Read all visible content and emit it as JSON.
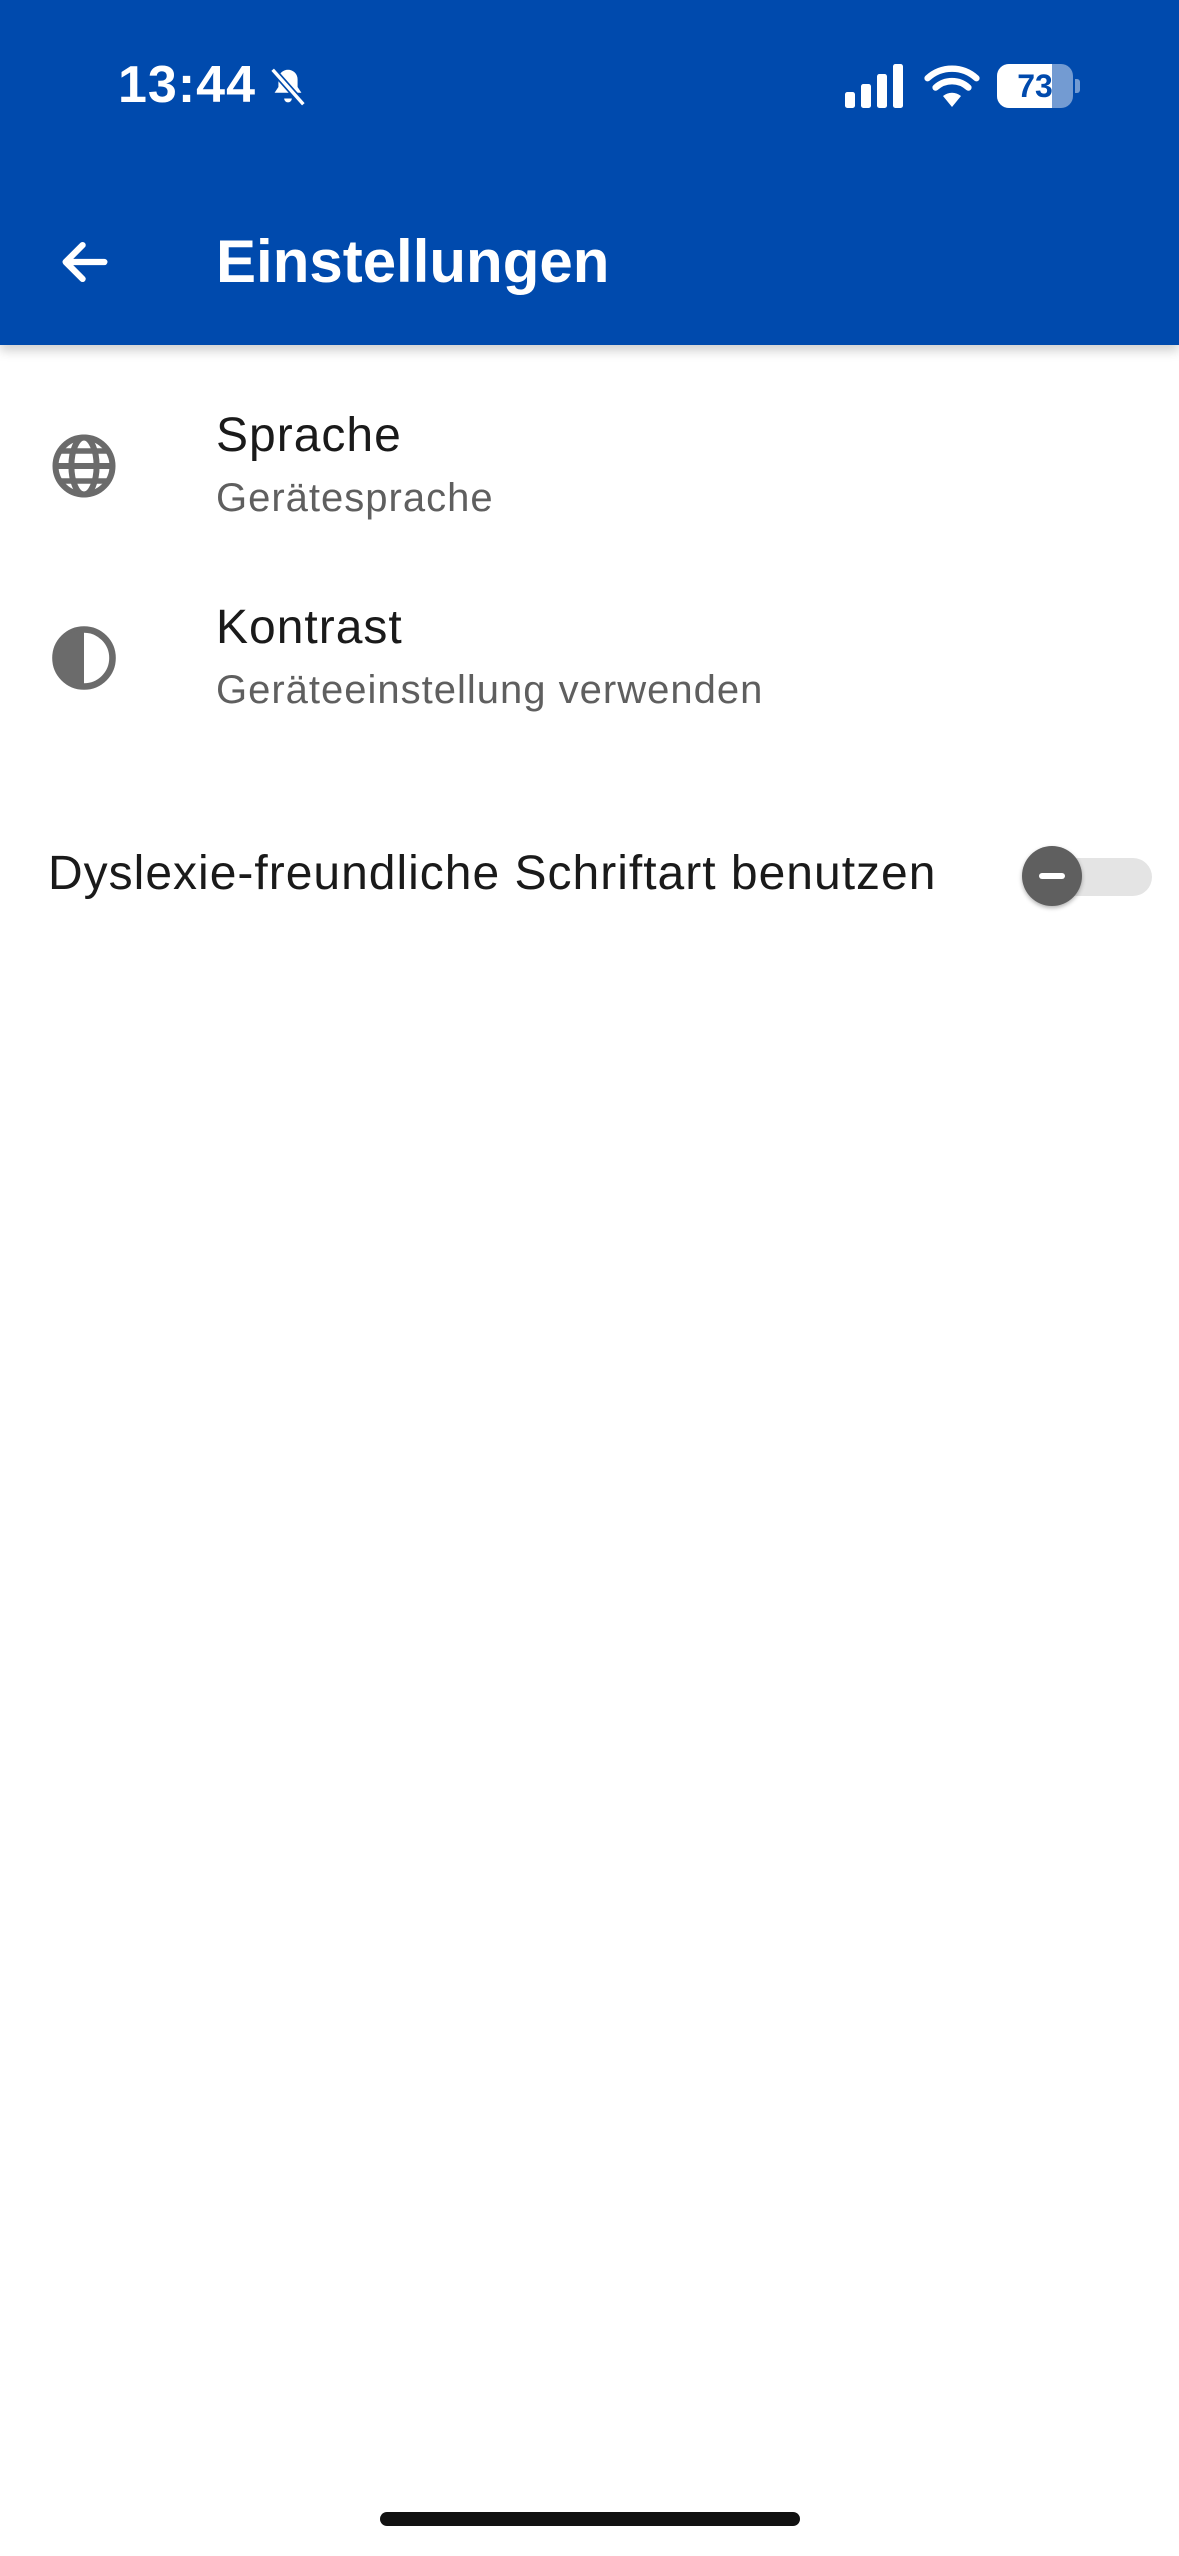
{
  "status_bar": {
    "time": "13:44",
    "battery": "73",
    "battery_level": 0.73,
    "icons": [
      "bell-muted-icon",
      "cellular-signal-icon",
      "wifi-icon",
      "battery-icon"
    ]
  },
  "app_bar": {
    "title": "Einstellungen",
    "back_icon": "arrow-left-icon",
    "color": "#004aad"
  },
  "settings": {
    "items": [
      {
        "title": "Sprache",
        "subtitle": "Gerätesprache",
        "icon": "globe-icon"
      },
      {
        "title": "Kontrast",
        "subtitle": "Geräteeinstellung verwenden",
        "icon": "contrast-icon"
      }
    ],
    "dyslexia_font": {
      "label": "Dyslexie-freundliche Schriftart benutzen",
      "enabled": false
    }
  }
}
